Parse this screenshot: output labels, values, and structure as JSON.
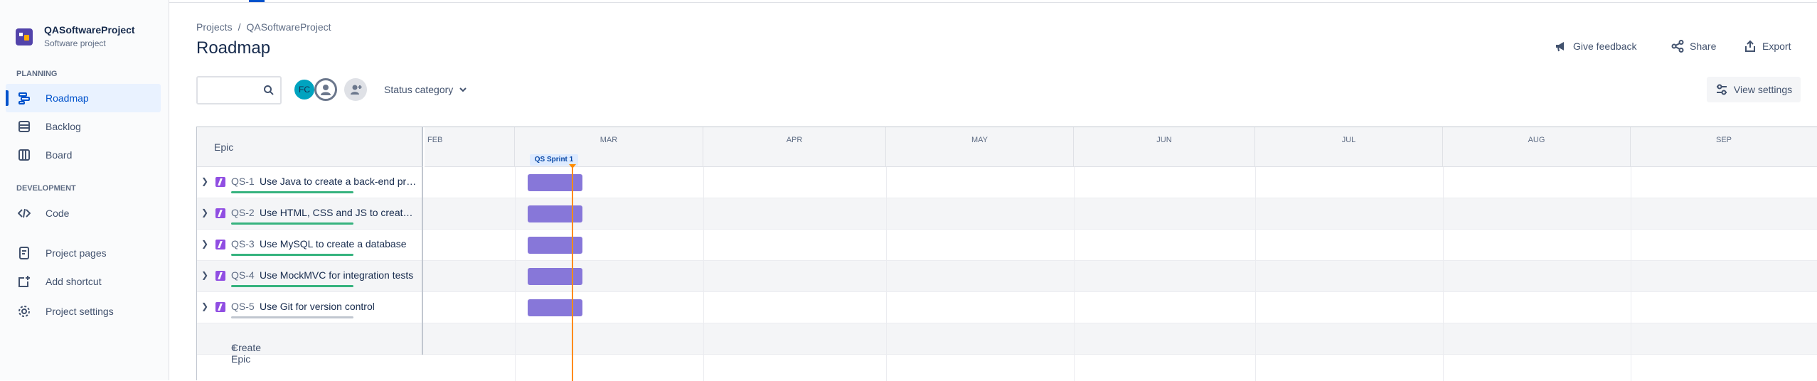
{
  "sidebar": {
    "project_name": "QASoftwareProject",
    "project_type": "Software project",
    "planning_label": "PLANNING",
    "development_label": "DEVELOPMENT",
    "items": [
      {
        "label": "Roadmap",
        "icon": "roadmap-icon",
        "active": true
      },
      {
        "label": "Backlog",
        "icon": "backlog-icon"
      },
      {
        "label": "Board",
        "icon": "board-icon"
      },
      {
        "label": "Code",
        "icon": "code-icon"
      },
      {
        "label": "Project pages",
        "icon": "pages-icon"
      },
      {
        "label": "Add shortcut",
        "icon": "add-shortcut-icon"
      },
      {
        "label": "Project settings",
        "icon": "gear-icon"
      }
    ]
  },
  "breadcrumb": {
    "root": "Projects",
    "sep": "/",
    "project": "QASoftwareProject"
  },
  "page_title": "Roadmap",
  "actions": {
    "feedback": "Give feedback",
    "share": "Share",
    "export": "Export"
  },
  "toolbar": {
    "search_placeholder": "",
    "avatar_initials": "FC",
    "status_category": "Status category",
    "view_settings": "View settings"
  },
  "timeline": {
    "epic_header": "Epic",
    "months": [
      "FEB",
      "MAR",
      "APR",
      "MAY",
      "JUN",
      "JUL",
      "AUG",
      "SEP"
    ],
    "sprint_label": "QS Sprint 1",
    "create_epic": "Create Epic"
  },
  "epics": [
    {
      "key": "QS-1",
      "summary": "Use Java to create a back-end program",
      "progress_color": "#36b37e"
    },
    {
      "key": "QS-2",
      "summary": "Use HTML, CSS and JS to create a front-end",
      "progress_color": "#36b37e"
    },
    {
      "key": "QS-3",
      "summary": "Use MySQL to create a database",
      "progress_color": "#36b37e"
    },
    {
      "key": "QS-4",
      "summary": "Use MockMVC for integration tests",
      "progress_color": "#36b37e"
    },
    {
      "key": "QS-5",
      "summary": "Use Git for version control",
      "progress_color": "#c1c7d0"
    }
  ],
  "colors": {
    "accent": "#0052cc",
    "epic_bar": "#8777d9",
    "today_line": "#ff8b00",
    "epic_icon": "#904ee2"
  }
}
